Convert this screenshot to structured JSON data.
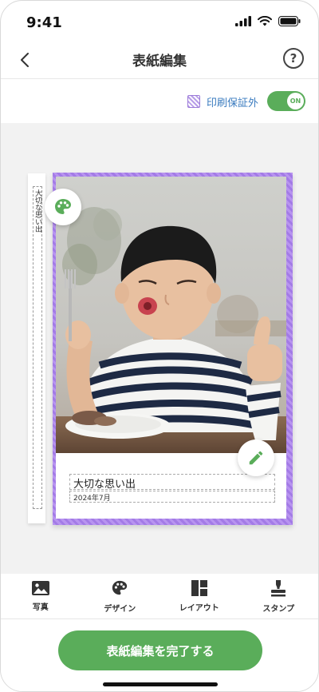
{
  "status_bar": {
    "time": "9:41"
  },
  "header": {
    "title": "表紙編集"
  },
  "print_toggle": {
    "label": "印刷保証外",
    "state": "ON"
  },
  "spine": {
    "text": "大切な思い出"
  },
  "cover": {
    "title": "大切な思い出",
    "date": "2024年7月"
  },
  "tabs": [
    {
      "label": "写真",
      "icon": "photo-icon"
    },
    {
      "label": "デザイン",
      "icon": "palette-icon"
    },
    {
      "label": "レイアウト",
      "icon": "layout-icon"
    },
    {
      "label": "スタンプ",
      "icon": "stamp-icon"
    }
  ],
  "finish_button": {
    "label": "表紙編集を完了する"
  },
  "colors": {
    "accent": "#5aad5a",
    "print_frame": "#a37be6",
    "link": "#3a7bbf"
  }
}
